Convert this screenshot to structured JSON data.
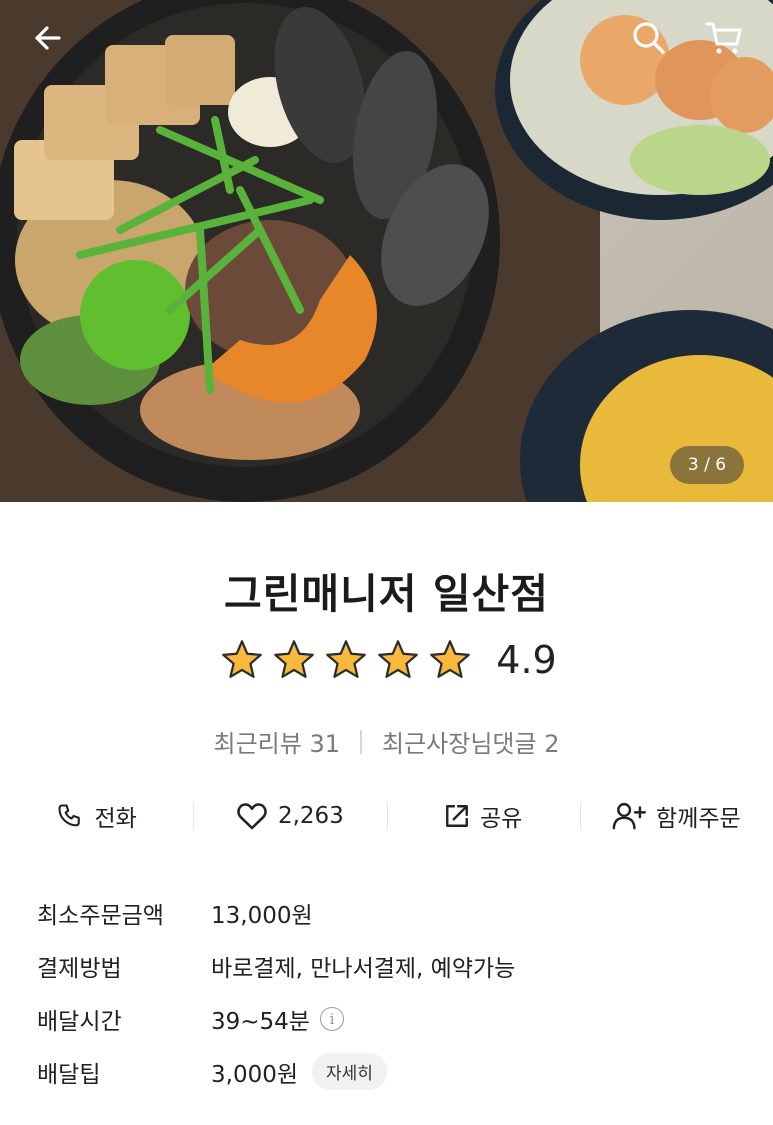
{
  "hero": {
    "counter": "3 / 6"
  },
  "store": {
    "name": "그린매니저 일산점",
    "rating": "4.9",
    "rating_value": 4.9,
    "stars_filled": 5
  },
  "reviews": {
    "recent_reviews": "최근리뷰 31",
    "owner_comments": "최근사장님댓글 2"
  },
  "actions": {
    "call": "전화",
    "likes": "2,263",
    "share": "공유",
    "group_order": "함께주문"
  },
  "info": {
    "min_order_label": "최소주문금액",
    "min_order_value": "13,000원",
    "payment_label": "결제방법",
    "payment_value": "바로결제, 만나서결제, 예약가능",
    "delivery_time_label": "배달시간",
    "delivery_time_value": "39~54분",
    "delivery_tip_label": "배달팁",
    "delivery_tip_value": "3,000원",
    "detail_button": "자세히"
  },
  "icons": {
    "back": "back-arrow-icon",
    "search": "search-icon",
    "cart": "cart-icon",
    "star": "star-icon",
    "phone": "phone-icon",
    "heart": "heart-icon",
    "share": "share-icon",
    "add_user": "add-user-icon",
    "info": "info-icon"
  },
  "colors": {
    "star": "#f6b93b",
    "text": "#222222",
    "muted": "#7a7a7a"
  }
}
